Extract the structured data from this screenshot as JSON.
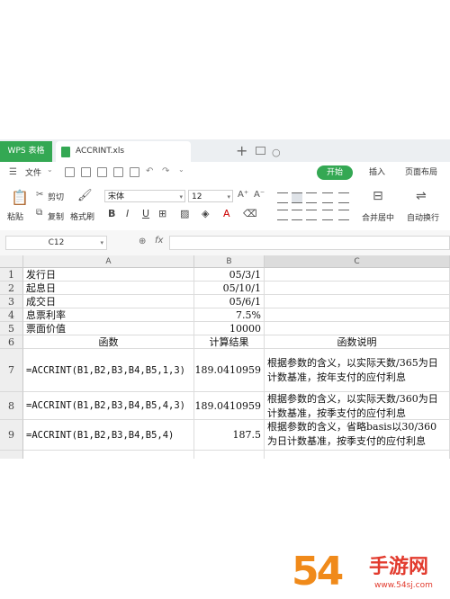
{
  "titlebar": {
    "app_tab": "WPS 表格",
    "file_tab": "ACCRINT.xls",
    "close_glyph": "○",
    "add_glyph": "+"
  },
  "menu": {
    "file_label": "文件",
    "start_tab": "开始",
    "insert_tab": "插入",
    "layout_tab": "页面布局"
  },
  "ribbon": {
    "paste_label": "粘贴",
    "cut_label": "剪切",
    "copy_label": "复制",
    "format_painter_label": "格式刷",
    "font_name": "宋体",
    "font_size": "12",
    "merge_label": "合并居中",
    "wrap_label": "自动换行"
  },
  "formula_bar": {
    "cell_ref": "C12",
    "fx_label": "fx",
    "formula": ""
  },
  "grid": {
    "columns": [
      "A",
      "B",
      "C"
    ],
    "rows": [
      {
        "num": "1",
        "a": "发行日",
        "b": "05/3/1",
        "c": ""
      },
      {
        "num": "2",
        "a": "起息日",
        "b": "05/10/1",
        "c": ""
      },
      {
        "num": "3",
        "a": "成交日",
        "b": "05/6/1",
        "c": ""
      },
      {
        "num": "4",
        "a": "息票利率",
        "b": "7.5%",
        "c": ""
      },
      {
        "num": "5",
        "a": "票面价值",
        "b": "10000",
        "c": ""
      },
      {
        "num": "6",
        "a": "函数",
        "b": "计算结果",
        "c": "函数说明"
      },
      {
        "num": "7",
        "a": "=ACCRINT(B1,B2,B3,B4,B5,1,3)",
        "b": "189.0410959",
        "c": "根据参数的含义，以实际天数/365为日计数基准，按年支付的应付利息"
      },
      {
        "num": "8",
        "a": "=ACCRINT(B1,B2,B3,B4,B5,4,3)",
        "b": "189.0410959",
        "c": "根据参数的含义，以实际天数/360为日计数基准，按季支付的应付利息"
      },
      {
        "num": "9",
        "a": "=ACCRINT(B1,B2,B3,B4,B5,4)",
        "b": "187.5",
        "c": "根据参数的含义，省略basis以30/360为日计数基准，按季支付的应付利息"
      }
    ]
  },
  "watermark": {
    "digits": "54",
    "site_name": "手游网",
    "url": "www.54sj.com"
  },
  "colors": {
    "accent_green": "#34a853",
    "watermark_orange": "#f08a1a",
    "watermark_red": "#e23b2e"
  }
}
